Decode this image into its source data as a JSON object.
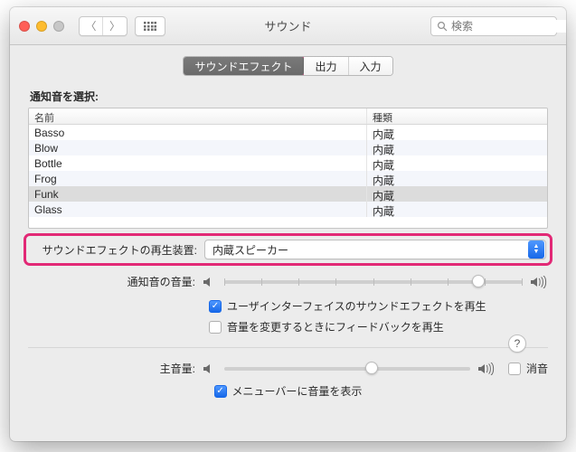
{
  "window": {
    "title": "サウンド"
  },
  "search": {
    "placeholder": "検索"
  },
  "tabs": [
    {
      "label": "サウンドエフェクト",
      "active": true
    },
    {
      "label": "出力",
      "active": false
    },
    {
      "label": "入力",
      "active": false
    }
  ],
  "alert_section_label": "通知音を選択:",
  "columns": {
    "name": "名前",
    "kind": "種類"
  },
  "sounds": [
    {
      "name": "Basso",
      "kind": "内蔵",
      "selected": false
    },
    {
      "name": "Blow",
      "kind": "内蔵",
      "selected": false
    },
    {
      "name": "Bottle",
      "kind": "内蔵",
      "selected": false
    },
    {
      "name": "Frog",
      "kind": "内蔵",
      "selected": false
    },
    {
      "name": "Funk",
      "kind": "内蔵",
      "selected": true
    },
    {
      "name": "Glass",
      "kind": "内蔵",
      "selected": false
    }
  ],
  "device": {
    "label": "サウンドエフェクトの再生装置:",
    "value": "内蔵スピーカー"
  },
  "alert_volume": {
    "label": "通知音の音量:",
    "value": 0.85
  },
  "checks": {
    "ui_sounds": {
      "label": "ユーザインターフェイスのサウンドエフェクトを再生",
      "checked": true
    },
    "volume_feedback": {
      "label": "音量を変更するときにフィードバックを再生",
      "checked": false
    }
  },
  "main_volume": {
    "label": "主音量:",
    "value": 0.6
  },
  "mute": {
    "label": "消音",
    "checked": false
  },
  "menu_bar": {
    "label": "メニューバーに音量を表示",
    "checked": true
  },
  "icons": {
    "chevron_left": "chevron-left-icon",
    "chevron_right": "chevron-right-icon",
    "grid": "grid-icon",
    "search": "search-icon",
    "speaker_low": "speaker-low-icon",
    "speaker_high": "speaker-high-icon",
    "help": "help-icon"
  }
}
